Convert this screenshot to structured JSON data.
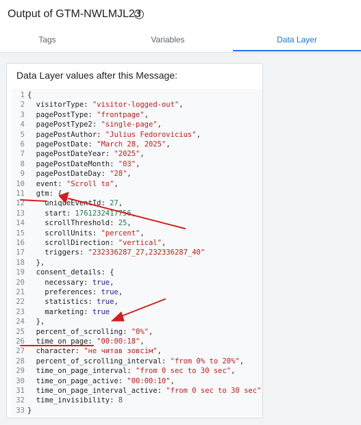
{
  "header": {
    "title": "Output of GTM-NWLMJL23",
    "help_icon": "help-circle-icon"
  },
  "tabs": [
    {
      "label": "Tags",
      "active": false
    },
    {
      "label": "Variables",
      "active": false
    },
    {
      "label": "Data Layer",
      "active": true
    }
  ],
  "panel": {
    "title": "Data Layer values after this Message:"
  },
  "code": [
    {
      "n": "1",
      "parts": [
        [
          "p",
          "{"
        ]
      ]
    },
    {
      "n": "2",
      "parts": [
        [
          "p",
          "  visitorType: "
        ],
        [
          "s",
          "\"visitor-logged-out\""
        ],
        [
          "p",
          ","
        ]
      ]
    },
    {
      "n": "3",
      "parts": [
        [
          "p",
          "  pagePostType: "
        ],
        [
          "s",
          "\"frontpage\""
        ],
        [
          "p",
          ","
        ]
      ]
    },
    {
      "n": "4",
      "parts": [
        [
          "p",
          "  pagePostType2: "
        ],
        [
          "s",
          "\"single-page\""
        ],
        [
          "p",
          ","
        ]
      ]
    },
    {
      "n": "5",
      "parts": [
        [
          "p",
          "  pagePostAuthor: "
        ],
        [
          "s",
          "\"Julius Fedorovicius\""
        ],
        [
          "p",
          ","
        ]
      ]
    },
    {
      "n": "6",
      "parts": [
        [
          "p",
          "  pagePostDate: "
        ],
        [
          "s",
          "\"March 28, 2025\""
        ],
        [
          "p",
          ","
        ]
      ]
    },
    {
      "n": "7",
      "parts": [
        [
          "p",
          "  pagePostDateYear: "
        ],
        [
          "s",
          "\"2025\""
        ],
        [
          "p",
          ","
        ]
      ]
    },
    {
      "n": "8",
      "parts": [
        [
          "p",
          "  pagePostDateMonth: "
        ],
        [
          "s",
          "\"03\""
        ],
        [
          "p",
          ","
        ]
      ]
    },
    {
      "n": "9",
      "parts": [
        [
          "p",
          "  pagePostDateDay: "
        ],
        [
          "s",
          "\"28\""
        ],
        [
          "p",
          ","
        ]
      ]
    },
    {
      "n": "10",
      "parts": [
        [
          "p",
          "  event: "
        ],
        [
          "s",
          "\"Scroll to\""
        ],
        [
          "p",
          ","
        ]
      ]
    },
    {
      "n": "11",
      "parts": [
        [
          "p",
          "  gtm: {"
        ]
      ]
    },
    {
      "n": "12",
      "parts": [
        [
          "p",
          "    uniqueEventId: "
        ],
        [
          "d",
          "27"
        ],
        [
          "p",
          ","
        ]
      ]
    },
    {
      "n": "13",
      "parts": [
        [
          "p",
          "    start: "
        ],
        [
          "d",
          "1761232417756"
        ],
        [
          "p",
          ","
        ]
      ]
    },
    {
      "n": "14",
      "parts": [
        [
          "p",
          "    scrollThreshold: "
        ],
        [
          "d",
          "25"
        ],
        [
          "p",
          ","
        ]
      ]
    },
    {
      "n": "15",
      "parts": [
        [
          "p",
          "    scrollUnits: "
        ],
        [
          "s",
          "\"percent\""
        ],
        [
          "p",
          ","
        ]
      ]
    },
    {
      "n": "16",
      "parts": [
        [
          "p",
          "    scrollDirection: "
        ],
        [
          "s",
          "\"vertical\""
        ],
        [
          "p",
          ","
        ]
      ]
    },
    {
      "n": "17",
      "parts": [
        [
          "p",
          "    triggers: "
        ],
        [
          "s",
          "\"232336287_27,232336287_40\""
        ]
      ]
    },
    {
      "n": "18",
      "parts": [
        [
          "p",
          "  },"
        ]
      ]
    },
    {
      "n": "19",
      "parts": [
        [
          "p",
          "  consent_details: {"
        ]
      ]
    },
    {
      "n": "20",
      "parts": [
        [
          "p",
          "    necessary: "
        ],
        [
          "k",
          "true"
        ],
        [
          "p",
          ","
        ]
      ]
    },
    {
      "n": "21",
      "parts": [
        [
          "p",
          "    preferences: "
        ],
        [
          "k",
          "true"
        ],
        [
          "p",
          ","
        ]
      ]
    },
    {
      "n": "22",
      "parts": [
        [
          "p",
          "    statistics: "
        ],
        [
          "k",
          "true"
        ],
        [
          "p",
          ","
        ]
      ]
    },
    {
      "n": "23",
      "parts": [
        [
          "p",
          "    marketing: "
        ],
        [
          "k",
          "true"
        ]
      ]
    },
    {
      "n": "24",
      "parts": [
        [
          "p",
          "  },"
        ]
      ]
    },
    {
      "n": "25",
      "parts": [
        [
          "p",
          "  percent_of_scrolling: "
        ],
        [
          "s",
          "\"0%\""
        ],
        [
          "p",
          ","
        ]
      ]
    },
    {
      "n": "26",
      "parts": [
        [
          "p",
          "  time_on_page: "
        ],
        [
          "s",
          "\"00:00:18\""
        ],
        [
          "p",
          ","
        ]
      ]
    },
    {
      "n": "27",
      "parts": [
        [
          "p",
          "  character: "
        ],
        [
          "s",
          "\"не читав зовсім\""
        ],
        [
          "p",
          ","
        ]
      ]
    },
    {
      "n": "28",
      "parts": [
        [
          "p",
          "  percent_of_scrolling_interval: "
        ],
        [
          "s",
          "\"from 0% to 20%\""
        ],
        [
          "p",
          ","
        ]
      ]
    },
    {
      "n": "29",
      "parts": [
        [
          "p",
          "  time_on_page_interval: "
        ],
        [
          "s",
          "\"from 0 sec to 30 sec\""
        ],
        [
          "p",
          ","
        ]
      ]
    },
    {
      "n": "30",
      "parts": [
        [
          "p",
          "  time_on_page_active: "
        ],
        [
          "s",
          "\"00:00:10\""
        ],
        [
          "p",
          ","
        ]
      ]
    },
    {
      "n": "31",
      "parts": [
        [
          "p",
          "  time_on_page_interval_active: "
        ],
        [
          "s",
          "\"from 0 sec to 30 sec\""
        ],
        [
          "p",
          ","
        ]
      ]
    },
    {
      "n": "32",
      "parts": [
        [
          "p",
          "  time_invisibility: "
        ],
        [
          "d",
          "8"
        ]
      ]
    },
    {
      "n": "33",
      "parts": [
        [
          "p",
          "}"
        ]
      ]
    }
  ],
  "colors": {
    "accent": "#1a73e8",
    "string": "#c41a16",
    "number": "#1c7a48",
    "keyword": "#1a1aa6",
    "annotation": "#d81b1b"
  }
}
